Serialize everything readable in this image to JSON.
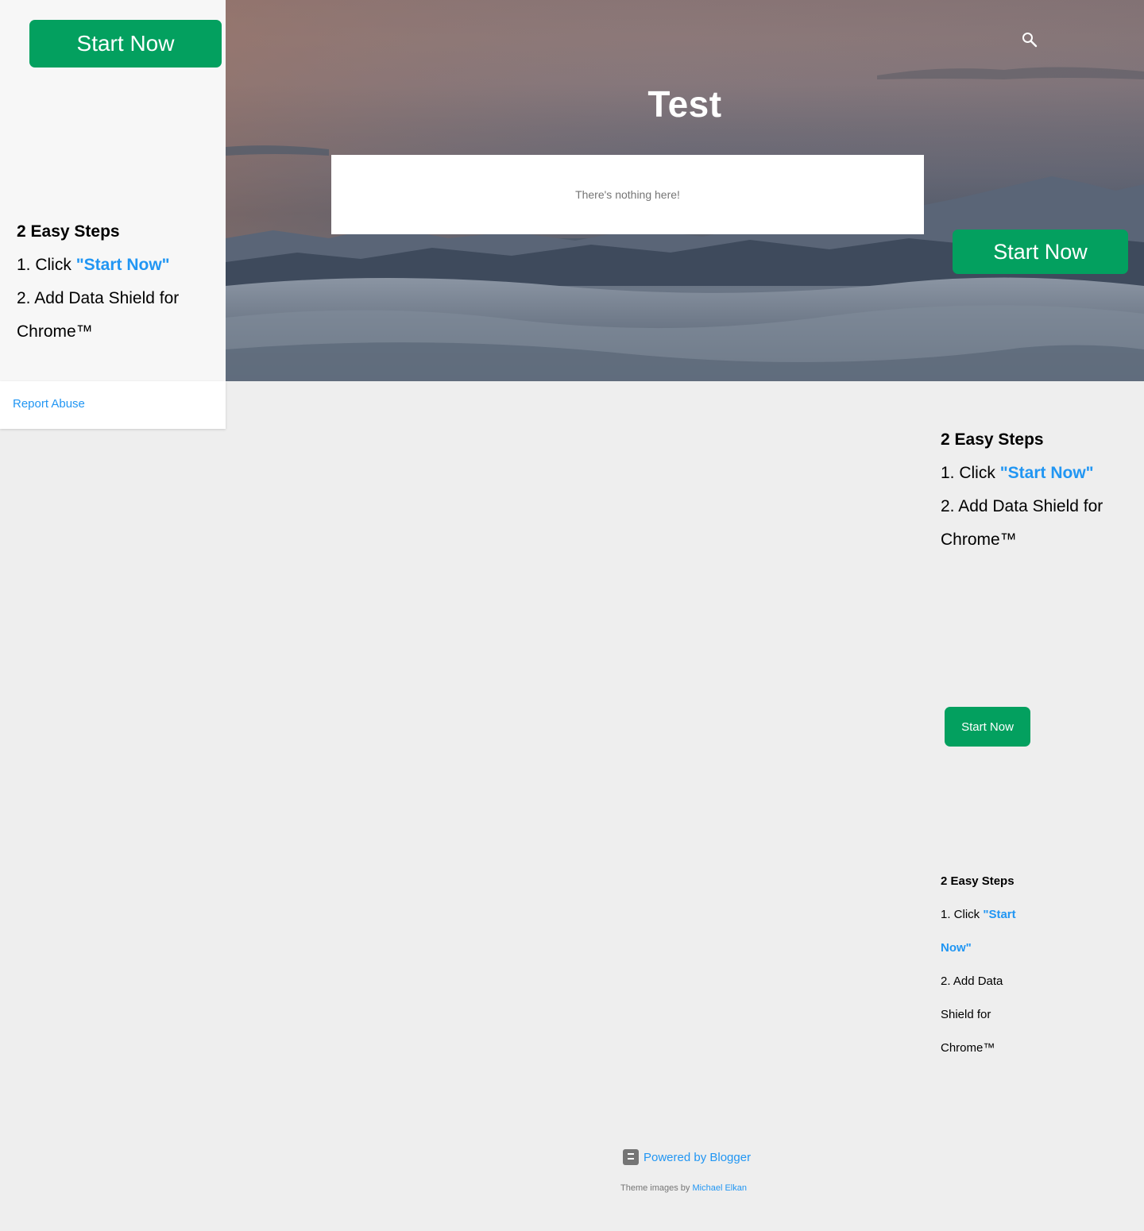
{
  "hero": {
    "title": "Test",
    "empty_message": "There's nothing here!",
    "search_icon": "search-icon"
  },
  "buttons": {
    "top_start": "Start Now",
    "hero_start": "Start Now",
    "small_start": "Start Now"
  },
  "steps_large": {
    "title": "2 Easy Steps",
    "step1_prefix": "1. Click ",
    "step1_link": "\"Start Now\"",
    "step2": "2. Add Data Shield for Chrome™"
  },
  "steps_small": {
    "title": "2 Easy Steps",
    "step1_prefix": "1. Click ",
    "step1_link": "\"Start Now\"",
    "step2": "2. Add Data Shield for Chrome™"
  },
  "sidebar": {
    "report_abuse": "Report Abuse"
  },
  "footer": {
    "powered_by": "Powered by Blogger",
    "theme_prefix": "Theme images by ",
    "theme_author": "Michael Elkan"
  },
  "colors": {
    "accent_green": "#03a05f",
    "link_blue": "#2196f3",
    "page_bg": "#eeeeee",
    "sidebar_bg": "#f7f7f7"
  }
}
